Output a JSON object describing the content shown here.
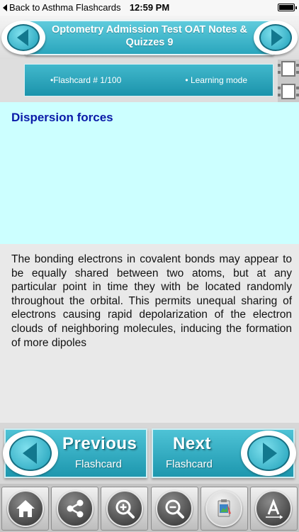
{
  "status_bar": {
    "back_label": "Back to Asthma Flashcards",
    "time": "12:59 PM"
  },
  "header": {
    "title": "Optometry Admission Test OAT Notes & Quizzes 9"
  },
  "info_bar": {
    "flashcard_label": "•Flashcard #  1/100",
    "mode_label": "• Learning mode"
  },
  "card": {
    "question": "Dispersion forces",
    "answer": "The bonding electrons in covalent bonds may appear to be equally shared between two atoms, but at any particular point in time they with be located randomly throughout the orbital. This permits unequal sharing of electrons causing rapid depolarization of the electron clouds of neighboring molecules, inducing the formation of more dipoles"
  },
  "nav": {
    "previous_big": "Previous",
    "previous_small": "Flashcard",
    "next_big": "Next",
    "next_small": "Flashcard"
  },
  "toolbar": {
    "icons": [
      "home-icon",
      "share-icon",
      "zoom-in-icon",
      "zoom-out-icon",
      "clipboard-icon",
      "font-size-icon"
    ]
  },
  "colors": {
    "accent": "#2aa6bd",
    "question_bg": "#ccffff",
    "question_text": "#0a1aa8"
  }
}
